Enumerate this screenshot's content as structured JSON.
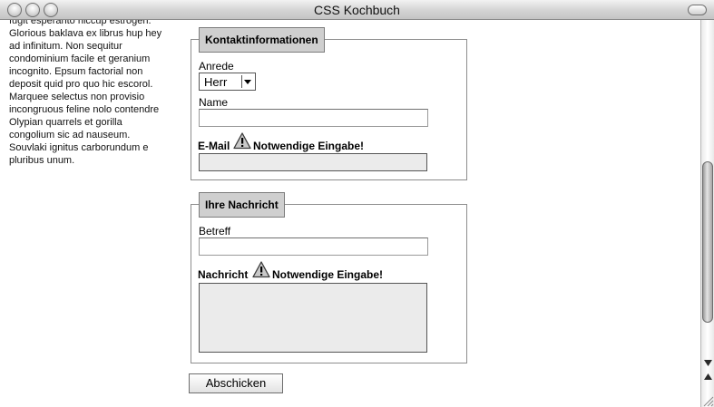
{
  "window": {
    "title": "CSS Kochbuch"
  },
  "sidebar": {
    "text": "fugit esperanto hiccup estrogen. Glorious baklava ex librus hup hey ad infinitum. Non sequitur condominium facile et geranium incognito. Epsum factorial non deposit quid pro quo hic escorol. Marquee selectus non provisio incongruous feline nolo contendre Olypian quarrels et gorilla congolium sic ad nauseum. Souvlaki ignitus carborundum e pluribus unum."
  },
  "form": {
    "contact": {
      "legend": "Kontaktinformationen",
      "salutation_label": "Anrede",
      "salutation_value": "Herr",
      "name_label": "Name",
      "name_value": "",
      "email_label": "E-Mail",
      "email_error": "Notwendige Eingabe!",
      "email_value": ""
    },
    "message": {
      "legend": "Ihre Nachricht",
      "subject_label": "Betreff",
      "subject_value": "",
      "message_label": "Nachricht",
      "message_error": "Notwendige Eingabe!",
      "message_value": ""
    },
    "submit_label": "Abschicken"
  },
  "icons": {
    "warning": "warning-icon"
  },
  "colors": {
    "legend_bg": "#cfcfcf",
    "error_field_bg": "#ebebeb"
  }
}
